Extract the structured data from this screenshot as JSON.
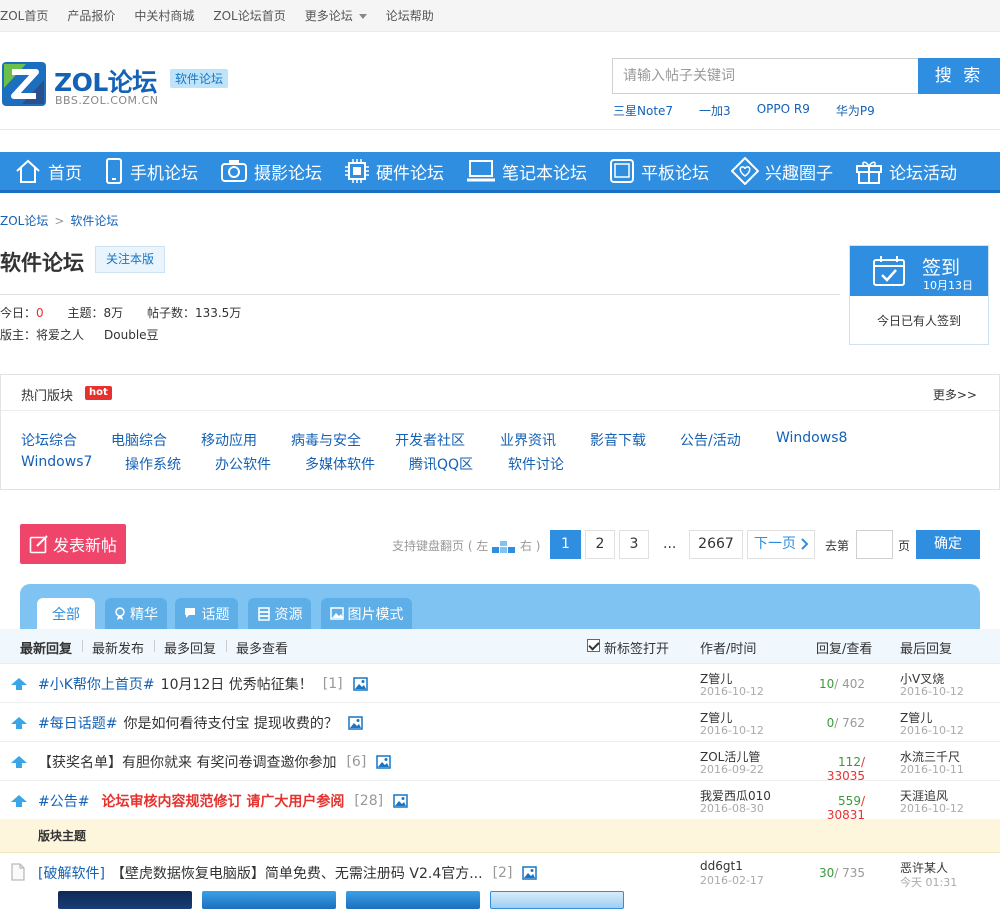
{
  "topbar": {
    "links": [
      "ZOL首页",
      "产品报价",
      "中关村商城",
      "ZOL论坛首页",
      "更多论坛",
      "论坛帮助"
    ]
  },
  "header": {
    "logo_title": "ZOL论坛",
    "logo_badge": "软件论坛",
    "logo_url": "BBS.ZOL.COM.CN",
    "search_placeholder": "请输入帖子关键词",
    "search_button": "搜 索",
    "hot_words": [
      "三星Note7",
      "一加3",
      "OPPO R9",
      "华为P9"
    ]
  },
  "nav": [
    {
      "label": "首页",
      "icon": "home-icon"
    },
    {
      "label": "手机论坛",
      "icon": "phone-icon"
    },
    {
      "label": "摄影论坛",
      "icon": "camera-icon"
    },
    {
      "label": "硬件论坛",
      "icon": "chip-icon"
    },
    {
      "label": "笔记本论坛",
      "icon": "laptop-icon"
    },
    {
      "label": "平板论坛",
      "icon": "tablet-icon"
    },
    {
      "label": "兴趣圈子",
      "icon": "heart-icon"
    },
    {
      "label": "论坛活动",
      "icon": "gift-icon"
    }
  ],
  "breadcrumb": {
    "root": "ZOL论坛",
    "current": "软件论坛",
    "sep": ">"
  },
  "forum": {
    "title": "软件论坛",
    "follow": "关注本版",
    "today_label": "今日：",
    "today_value": "0",
    "topics": "主题：8万",
    "posts": "帖子数：133.5万",
    "mods_label": "版主：",
    "mod1": "将爱之人",
    "mod2": "Double豆"
  },
  "sign": {
    "title": "签到",
    "date": "10月13日",
    "status": "今日已有人签到"
  },
  "hot_sections": {
    "title": "热门版块",
    "badge": "hot",
    "more": "更多>>",
    "row1": [
      "论坛综合",
      "电脑综合",
      "移动应用",
      "病毒与安全",
      "开发者社区",
      "业界资讯",
      "影音下载",
      "公告/活动",
      "Windows8"
    ],
    "row2": [
      "Windows7",
      "操作系统",
      "办公软件",
      "多媒体软件",
      "腾讯QQ区",
      "软件讨论"
    ]
  },
  "actions": {
    "post": "发表新帖",
    "pager_tip_left": "支持键盘翻页 ( 左",
    "pager_tip_right": "右 )",
    "pages": [
      "1",
      "2",
      "3"
    ],
    "ellipsis": "...",
    "last_page": "2667",
    "next": "下一页",
    "goto_left": "去第",
    "goto_right": "页",
    "ok": "确定"
  },
  "tabs": [
    "全部",
    "精华",
    "话题",
    "资源",
    "图片模式"
  ],
  "table_head": {
    "sort": [
      "最新回复",
      "最新发布",
      "最多回复",
      "最多查看"
    ],
    "newtab": "新标签打开",
    "author": "作者/时间",
    "reply": "回复/查看",
    "last": "最后回复"
  },
  "pinned": [
    {
      "tag": "#小K帮你上首页#",
      "title": "10月12日 优秀帖征集！",
      "highlight": "",
      "count": "[1]",
      "author": "Z管儿",
      "date": "2016-10-12",
      "replies": "10",
      "views": "/ 402",
      "views_red": false,
      "last": "小V叉烧",
      "ldate": "2016-10-12"
    },
    {
      "tag": "#每日话题#",
      "title": "你是如何看待支付宝 提现收费的？",
      "highlight": "",
      "count": "",
      "author": "Z管儿",
      "date": "2016-10-12",
      "replies": "0",
      "views": "/ 762",
      "views_red": false,
      "last": "Z管儿",
      "ldate": "2016-10-12"
    },
    {
      "tag": "",
      "title": "【获奖名单】有胆你就来 有奖问卷调查邀你参加",
      "highlight": "",
      "count": "[6]",
      "author": "ZOL活儿管",
      "date": "2016-09-22",
      "replies": "112",
      "views": "/ 33035",
      "views_red": true,
      "last": "水流三千尺",
      "ldate": "2016-10-11"
    },
    {
      "tag": "#公告#",
      "title": "",
      "highlight": "论坛审核内容规范修订 请广大用户参阅",
      "count": "[28]",
      "author": "我爱西瓜010",
      "date": "2016-08-30",
      "replies": "559",
      "views": "/ 30831",
      "views_red": true,
      "last": "天涯追风",
      "ldate": "2016-10-12"
    }
  ],
  "section_label": "版块主题",
  "topic": {
    "tag": "[破解软件]",
    "title": "【壁虎数据恢复电脑版】简单免费、无需注册码 V2.4官方...",
    "count": "[2]",
    "author": "dd6gt1",
    "date": "2016-02-17",
    "replies": "30",
    "views": "/ 735",
    "last": "恶许某人",
    "ldate": "今天 01:31"
  },
  "colors": {
    "accent": "#2f8ee0",
    "brand": "#1461b5",
    "post_button": "#f0456a",
    "red": "#e6322e",
    "green": "#3a9a3a"
  }
}
